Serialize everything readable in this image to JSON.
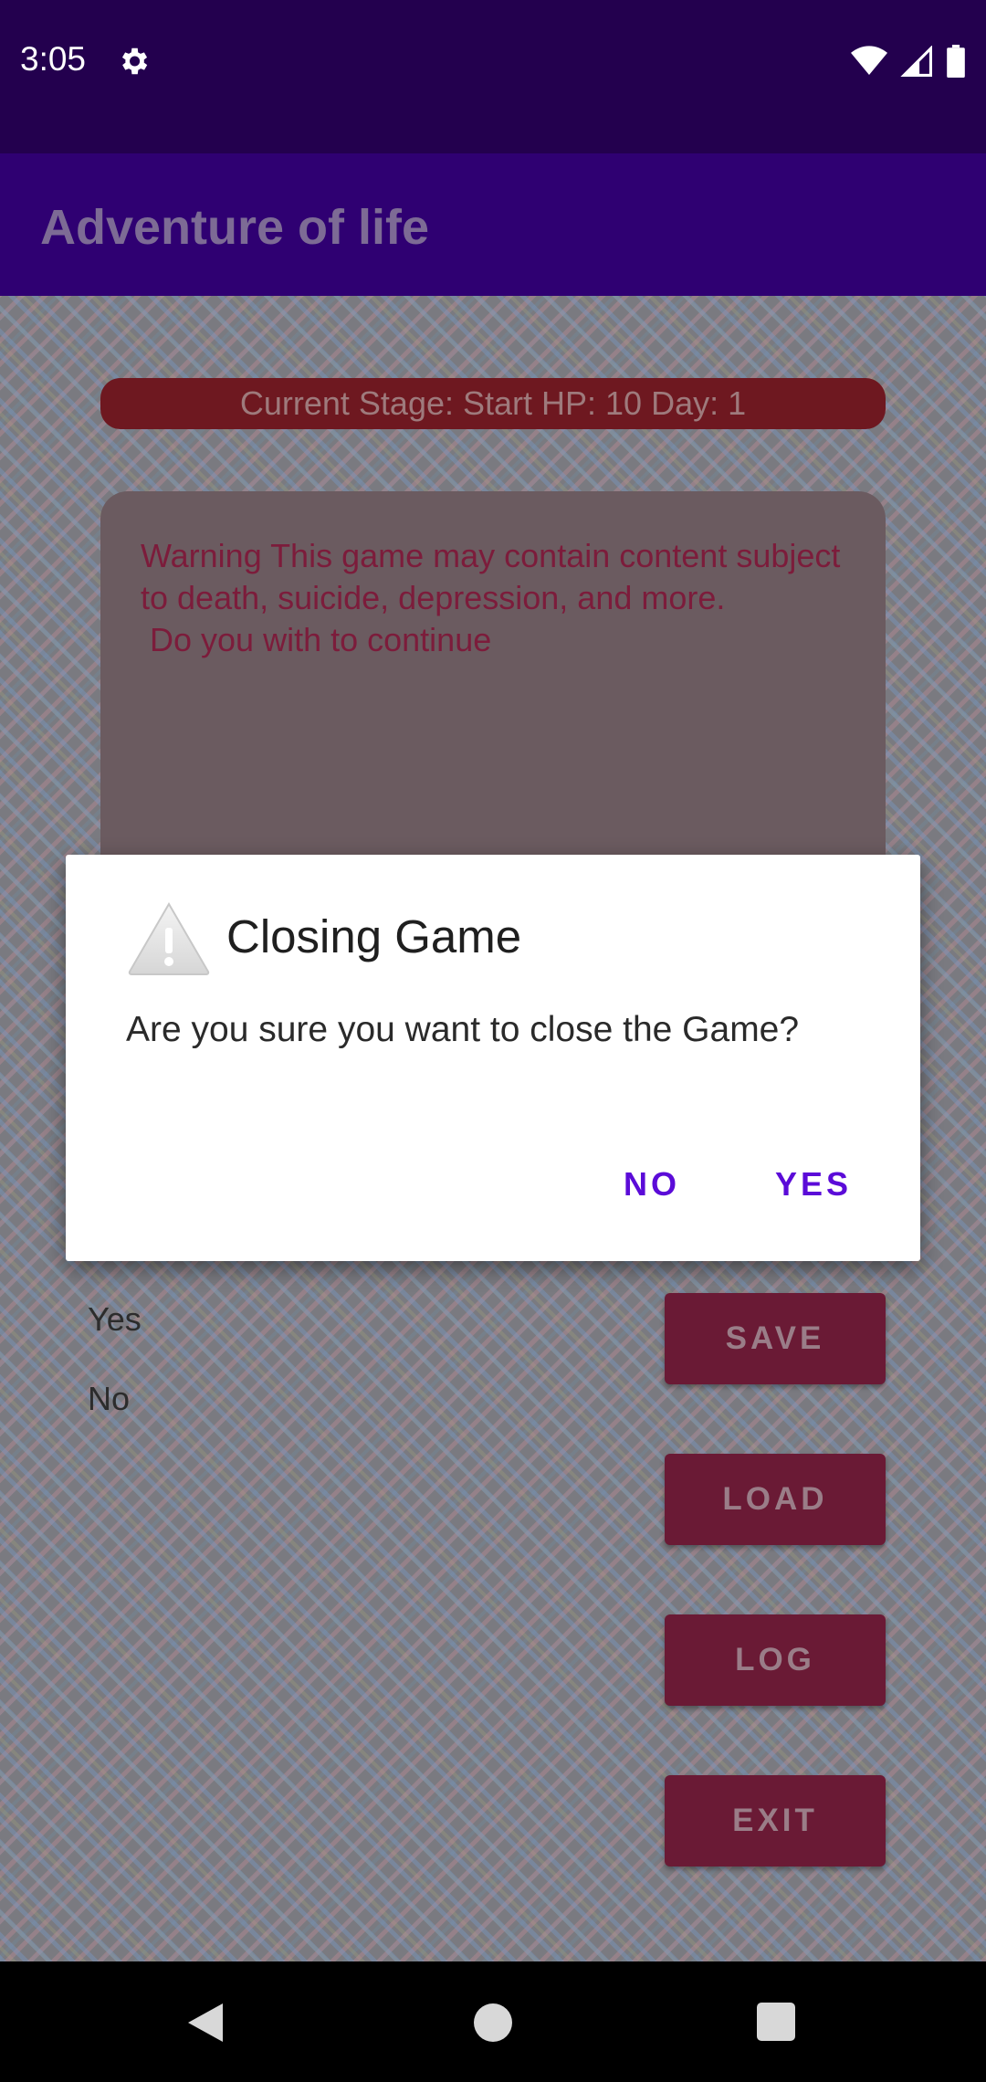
{
  "status_bar": {
    "time": "3:05",
    "icons": [
      "gear-icon",
      "wifi-icon",
      "signal-icon",
      "battery-icon"
    ]
  },
  "app_bar": {
    "title": "Adventure of life"
  },
  "game": {
    "stage_bar": "Current Stage: Start HP: 10 Day: 1",
    "story_text": "Warning This game may contain content subject to death, suicide, depression, and more.\n Do you with to continue",
    "choices": [
      "Yes",
      "No"
    ],
    "actions": {
      "save": "SAVE",
      "load": "LOAD",
      "log": "LOG",
      "exit": "EXIT"
    }
  },
  "dialog": {
    "icon": "warning-icon",
    "title": "Closing Game",
    "message": "Are you sure you want to close the Game?",
    "no_label": "NO",
    "yes_label": "YES"
  },
  "nav_bar": {
    "icons": [
      "back-icon",
      "home-icon",
      "recents-icon"
    ]
  },
  "colors": {
    "status_bar": "#23004e",
    "app_bar": "#2f0072",
    "dialog_button": "#5b0bd8",
    "action_button": "#6a1a35"
  }
}
